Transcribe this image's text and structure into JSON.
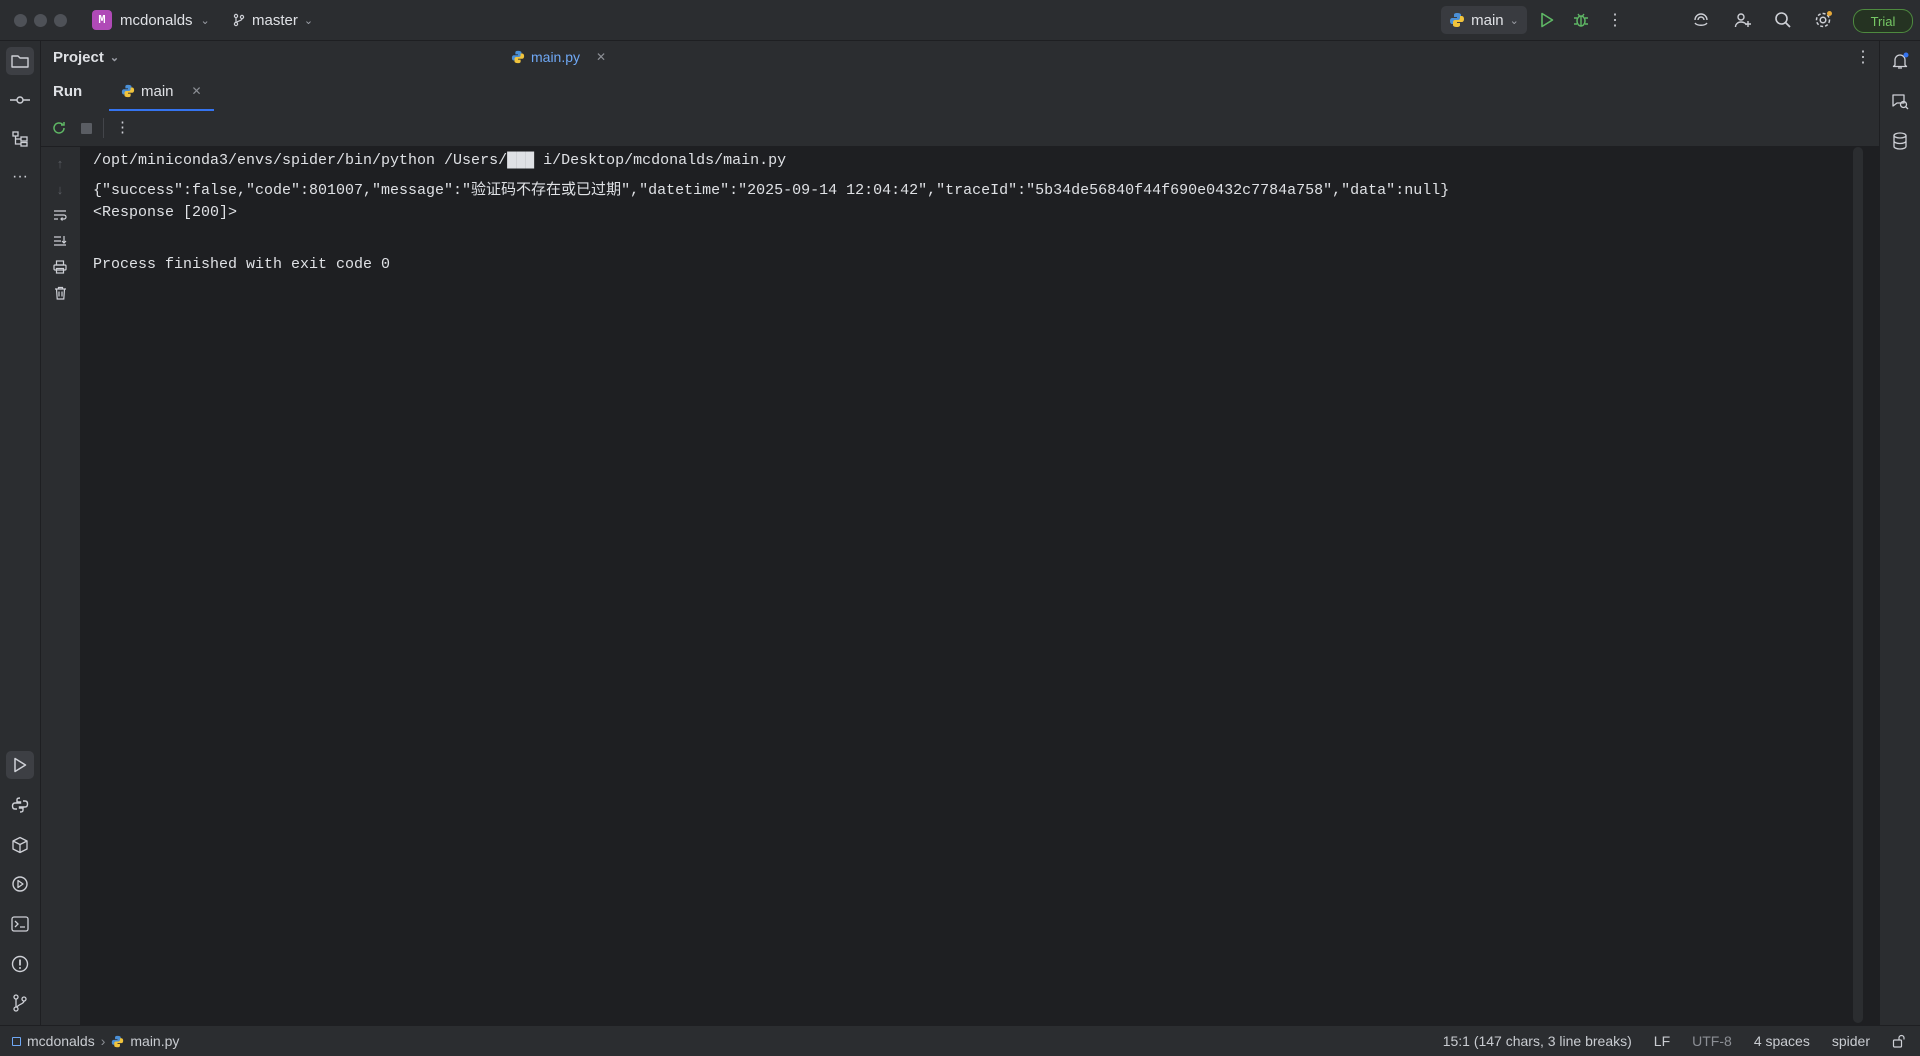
{
  "title_bar": {
    "project_badge": "M",
    "project_name": "mcdonalds",
    "branch": "master",
    "run_config": "main",
    "trial": "Trial"
  },
  "panel": {
    "project_label": "Project",
    "file_tab": "main.py"
  },
  "run": {
    "title": "Run",
    "tab": "main"
  },
  "console": {
    "lines": [
      "/opt/miniconda3/envs/spider/bin/python /Users/███ i/Desktop/mcdonalds/main.py",
      "{\"success\":false,\"code\":801007,\"message\":\"验证码不存在或已过期\",\"datetime\":\"2025-09-14 12:04:42\",\"traceId\":\"5b34de56840f44f690e0432c7784a758\",\"data\":null}",
      "<Response [200]>",
      "",
      "Process finished with exit code 0"
    ]
  },
  "status_bar": {
    "crumb_project": "mcdonalds",
    "crumb_file": "main.py",
    "position": "15:1 (147 chars, 3 line breaks)",
    "line_sep": "LF",
    "encoding": "UTF-8",
    "indent": "4 spaces",
    "interpreter": "spider"
  },
  "colors": {
    "accent": "#3574f0",
    "run_green": "#5fb865",
    "trial_green": "#76c865",
    "badge_purple": "#b04ab7"
  }
}
